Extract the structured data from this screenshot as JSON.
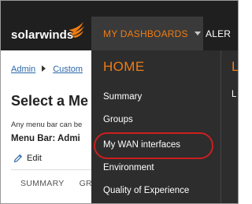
{
  "header": {
    "logo_text": "solarwinds",
    "nav": {
      "dashboards_label": "MY DASHBOARDS",
      "alerts_label": "ALER"
    }
  },
  "page": {
    "breadcrumb": {
      "first": "Admin",
      "second": "Custom"
    },
    "title": "Select a Me",
    "description": "Any menu bar can be",
    "menu_bar_label": "Menu Bar: Admi",
    "edit_label": "Edit",
    "tabs": [
      "SUMMARY",
      "GR"
    ]
  },
  "dropdown": {
    "column_heading": "HOME",
    "column2_heading": "L",
    "column2_item": "L",
    "items": [
      "Summary",
      "Groups",
      "My WAN interfaces",
      "Environment",
      "Quality of Experience"
    ],
    "highlighted_item": "My WAN interfaces"
  },
  "colors": {
    "accent_orange": "#f07c13",
    "topbar": "#1f1f1f",
    "dropdown_bg": "#2d2d2d",
    "highlight_ring": "#cc1f1f",
    "link_blue": "#2b67a8"
  },
  "icons": [
    "solarwinds-flame-icon",
    "caret-down-icon",
    "breadcrumb-arrow-icon",
    "pencil-icon"
  ]
}
